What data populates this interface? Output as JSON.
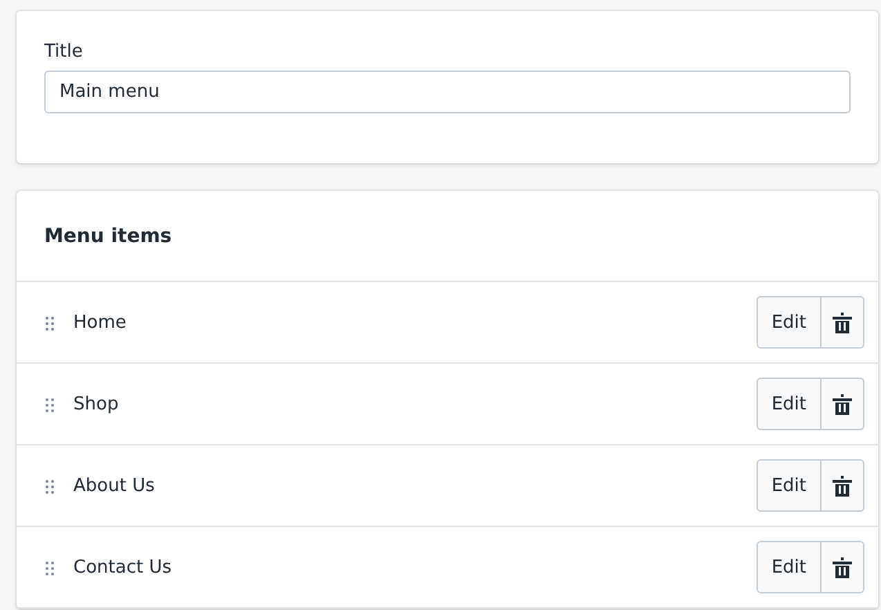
{
  "title_card": {
    "label": "Title",
    "value": "Main menu"
  },
  "menu": {
    "heading": "Menu items",
    "items": [
      {
        "label": "Home",
        "button": "Edit"
      },
      {
        "label": "Shop",
        "button": "Edit"
      },
      {
        "label": "About Us",
        "button": "Edit"
      },
      {
        "label": "Contact Us",
        "button": "Edit"
      }
    ]
  }
}
